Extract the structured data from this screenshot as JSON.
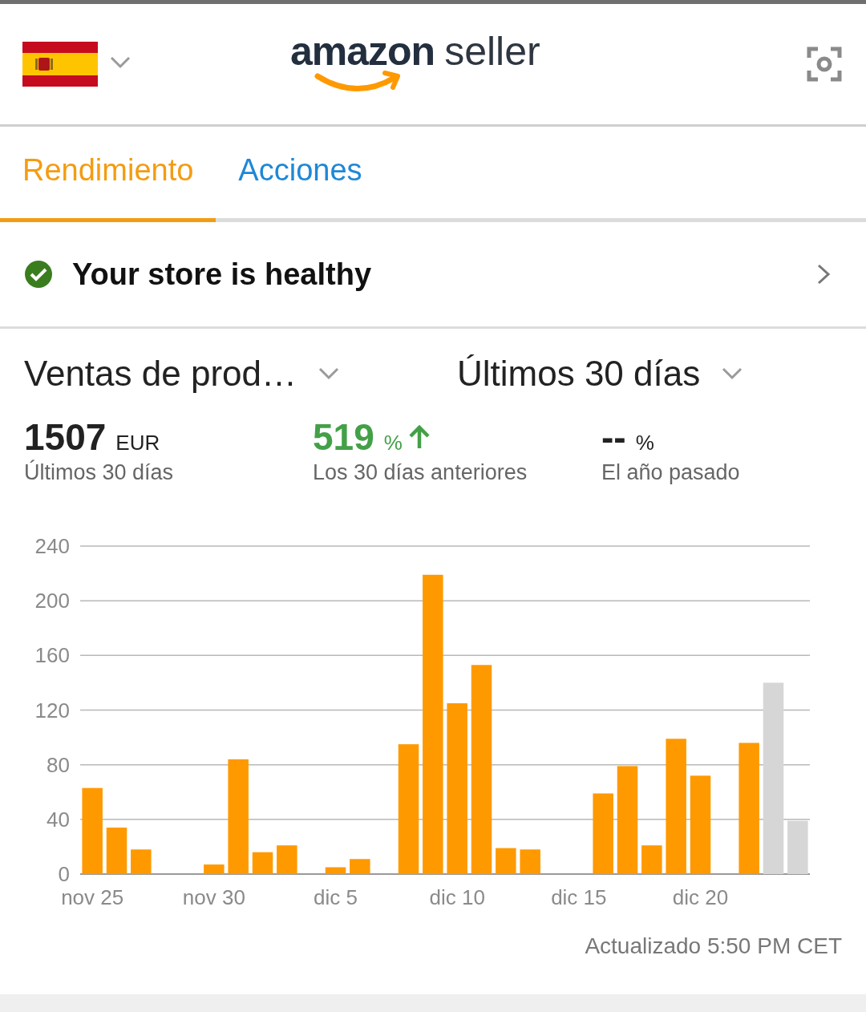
{
  "header": {
    "logo": {
      "brand": "amazon",
      "product": "seller"
    }
  },
  "tabs": [
    {
      "label": "Rendimiento",
      "selected": true
    },
    {
      "label": "Acciones",
      "selected": false
    }
  ],
  "health": {
    "ok": true,
    "text": "Your store is healthy"
  },
  "selectors": [
    {
      "value": "Ventas de prod…"
    },
    {
      "value": "Últimos 30 días"
    }
  ],
  "stats": [
    {
      "value": "1507",
      "unit": "EUR",
      "caption": "Últimos 30 días",
      "rising": false
    },
    {
      "value": "519",
      "unit": "%",
      "caption": "Los 30 días anteriores",
      "rising": true
    },
    {
      "value": "--",
      "unit": "%",
      "caption": "El año pasado",
      "rising": false
    }
  ],
  "chart": {
    "chart_data": {
      "type": "bar",
      "categories": [
        "nov 25",
        null,
        null,
        null,
        null,
        "nov 30",
        null,
        null,
        null,
        null,
        "dic 5",
        null,
        null,
        null,
        null,
        "dic 10",
        null,
        null,
        null,
        null,
        "dic 15",
        null,
        null,
        null,
        null,
        "dic 20",
        null,
        null,
        null,
        null
      ],
      "series": [
        {
          "color": "#ff9900",
          "values": [
            63,
            34,
            18,
            0,
            0,
            7,
            84,
            16,
            21,
            0,
            5,
            11,
            0,
            95,
            219,
            125,
            153,
            19,
            18,
            0,
            0,
            59,
            79,
            21,
            99,
            72,
            0,
            96,
            null,
            null
          ]
        },
        {
          "color": "#d6d6d6",
          "values": [
            null,
            null,
            null,
            null,
            null,
            null,
            null,
            null,
            null,
            null,
            null,
            null,
            null,
            null,
            null,
            null,
            null,
            null,
            null,
            null,
            null,
            null,
            null,
            null,
            null,
            null,
            null,
            null,
            140,
            39
          ]
        }
      ],
      "grid": true,
      "ylim": [
        0,
        240
      ],
      "yticks": [
        0,
        40,
        80,
        120,
        160,
        200,
        240
      ]
    }
  },
  "updated": "Actualizado 5:50 PM CET"
}
